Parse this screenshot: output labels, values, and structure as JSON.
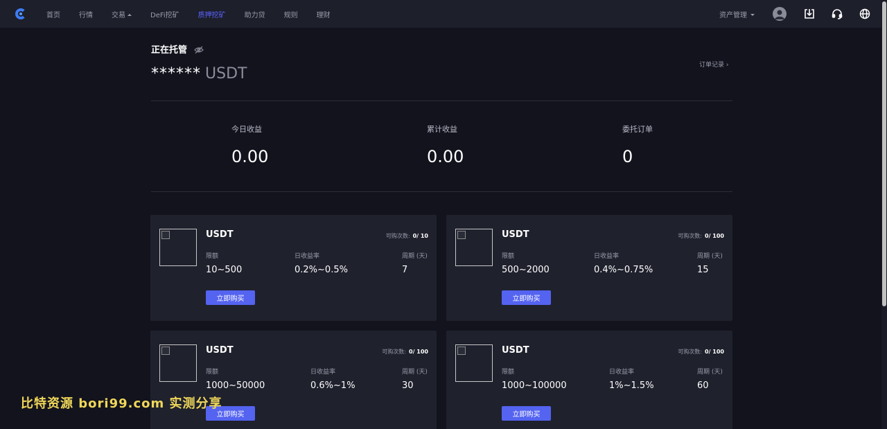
{
  "nav": {
    "items": [
      {
        "label": "首页",
        "active": false
      },
      {
        "label": "行情",
        "active": false
      },
      {
        "label": "交易",
        "active": false,
        "has_dropdown": true
      },
      {
        "label": "DeFi挖矿",
        "active": false
      },
      {
        "label": "质押挖矿",
        "active": true
      },
      {
        "label": "助力贷",
        "active": false
      },
      {
        "label": "规则",
        "active": false
      },
      {
        "label": "理财",
        "active": false
      }
    ],
    "asset_menu": "资产管理",
    "icons": [
      "avatar-icon",
      "download-icon",
      "headset-icon",
      "globe-icon"
    ]
  },
  "holding": {
    "title": "正在托管",
    "amount_masked": "******",
    "unit": "USDT",
    "order_link": "订单记录 ›"
  },
  "stats": [
    {
      "label": "今日收益",
      "value": "0.00"
    },
    {
      "label": "累计收益",
      "value": "0.00"
    },
    {
      "label": "委托订单",
      "value": "0"
    }
  ],
  "card_labels": {
    "limit": "限额",
    "daily_rate": "日收益率",
    "period": "周期 (天)",
    "avail_prefix": "可购次数:",
    "buy": "立即购买"
  },
  "products": [
    {
      "coin": "USDT",
      "avail": "0/ 10",
      "limit": "10~500",
      "rate": "0.2%~0.5%",
      "period": "7"
    },
    {
      "coin": "USDT",
      "avail": "0/ 100",
      "limit": "500~2000",
      "rate": "0.4%~0.75%",
      "period": "15"
    },
    {
      "coin": "USDT",
      "avail": "0/ 100",
      "limit": "1000~50000",
      "rate": "0.6%~1%",
      "period": "30"
    },
    {
      "coin": "USDT",
      "avail": "0/ 100",
      "limit": "1000~100000",
      "rate": "1%~1.5%",
      "period": "60"
    }
  ],
  "watermark": "比特资源 bori99.com 实测分享",
  "colors": {
    "background": "#12131d",
    "topbar": "#1d1f2b",
    "card": "#1f212d",
    "accent": "#5463f0",
    "nav_active": "#5b63ff"
  }
}
